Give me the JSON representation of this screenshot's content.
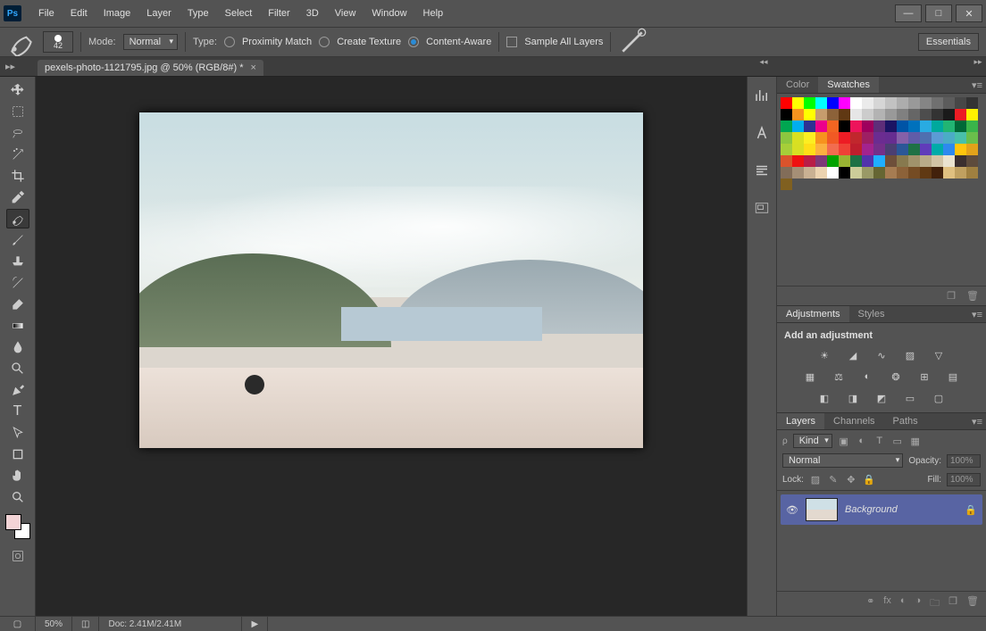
{
  "app": {
    "logo": "Ps"
  },
  "menu": [
    "File",
    "Edit",
    "Image",
    "Layer",
    "Type",
    "Select",
    "Filter",
    "3D",
    "View",
    "Window",
    "Help"
  ],
  "window_controls": {
    "min": "—",
    "max": "□",
    "close": "✕"
  },
  "options": {
    "brush_size": "42",
    "mode_label": "Mode:",
    "mode_value": "Normal",
    "type_label": "Type:",
    "radios": [
      {
        "label": "Proximity Match",
        "on": false
      },
      {
        "label": "Create Texture",
        "on": false
      },
      {
        "label": "Content-Aware",
        "on": true
      }
    ],
    "sample_all": "Sample All Layers",
    "essentials": "Essentials"
  },
  "doc_tab": {
    "title": "pexels-photo-1121795.jpg @ 50% (RGB/8#) *"
  },
  "panels": {
    "color_tab": "Color",
    "swatches_tab": "Swatches",
    "adjustments_tab": "Adjustments",
    "styles_tab": "Styles",
    "add_adjustment": "Add an adjustment",
    "layers_tab": "Layers",
    "channels_tab": "Channels",
    "paths_tab": "Paths"
  },
  "swatches": [
    "#ff0000",
    "#ffff00",
    "#00ff00",
    "#00ffff",
    "#0000ff",
    "#ff00ff",
    "#ffffff",
    "#ebebeb",
    "#d6d6d6",
    "#c2c2c2",
    "#adadad",
    "#999999",
    "#858585",
    "#707070",
    "#5c5c5c",
    "#474747",
    "#333333",
    "#000000",
    "#f7931e",
    "#ffff00",
    "#c69c6d",
    "#8c6239",
    "#603813",
    "#e6e6e6",
    "#cccccc",
    "#b3b3b3",
    "#999999",
    "#808080",
    "#666666",
    "#4d4d4d",
    "#333333",
    "#1a1a1a",
    "#ed1c24",
    "#fff200",
    "#00a651",
    "#00aeef",
    "#2e3192",
    "#ec008c",
    "#f26522",
    "#000000",
    "#ed145b",
    "#9e005d",
    "#5e2d79",
    "#1b1464",
    "#0054a6",
    "#0071bc",
    "#29abe2",
    "#00a99d",
    "#22b573",
    "#006837",
    "#39b54a",
    "#8cc63f",
    "#d9e021",
    "#fcee21",
    "#f7931e",
    "#f15a24",
    "#ed1c24",
    "#c1272d",
    "#9e1f63",
    "#6b2c91",
    "#662d91",
    "#8560a8",
    "#605ca8",
    "#4f6fb0",
    "#5b9bd5",
    "#4bacc6",
    "#48c0aa",
    "#6abf4b",
    "#a6ce39",
    "#d7df23",
    "#ffde17",
    "#fbb040",
    "#f26c4f",
    "#ef4136",
    "#be1e2d",
    "#a3238e",
    "#742f8a",
    "#4b3f72",
    "#2b5797",
    "#1e7145",
    "#603cba",
    "#00aba9",
    "#2d89ef",
    "#ffc40d",
    "#e3a21a",
    "#da532c",
    "#ee1111",
    "#b91d47",
    "#7e3878",
    "#00a300",
    "#99b433",
    "#1e7145",
    "#5133ab",
    "#1faeff",
    "#6e4f3a",
    "#87794e",
    "#a0926b",
    "#b9ab88",
    "#d2c4a5",
    "#ebe3cf",
    "#3b2f2f",
    "#5e4b3c",
    "#826d59",
    "#a58f76",
    "#c9b193",
    "#ecd3b0",
    "#ffffff",
    "#000000",
    "#cccc99",
    "#999966",
    "#666633",
    "#a67c52",
    "#8c6239",
    "#754c24",
    "#603913",
    "#42210b",
    "#e0c080",
    "#c0a060",
    "#a08040",
    "#806020"
  ],
  "layers_opts": {
    "kind_label": "Kind",
    "blend_mode": "Normal",
    "opacity_label": "Opacity:",
    "opacity_value": "100%",
    "lock_label": "Lock:",
    "fill_label": "Fill:",
    "fill_value": "100%"
  },
  "layer": {
    "name": "Background"
  },
  "status": {
    "zoom": "50%",
    "doc": "Doc: 2.41M/2.41M"
  }
}
